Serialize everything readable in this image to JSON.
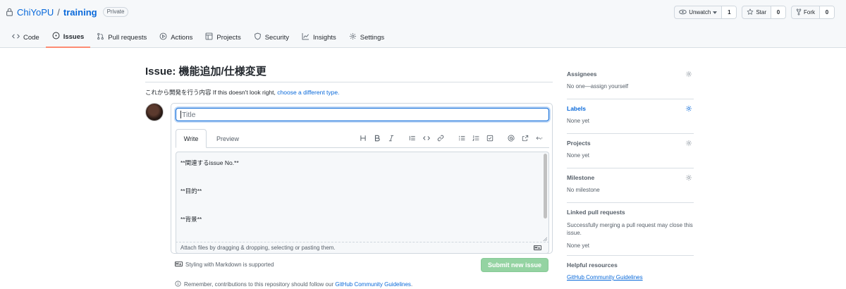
{
  "repo": {
    "owner": "ChiYoPU",
    "slash": "/",
    "name": "training",
    "visibility": "Private"
  },
  "repo_actions": {
    "watch_label": "Unwatch",
    "watch_count": "1",
    "star_label": "Star",
    "star_count": "0",
    "fork_label": "Fork",
    "fork_count": "0"
  },
  "tabs": [
    {
      "label": "Code",
      "icon": "code-icon"
    },
    {
      "label": "Issues",
      "icon": "issue-opened-icon",
      "active": true
    },
    {
      "label": "Pull requests",
      "icon": "pull-request-icon"
    },
    {
      "label": "Actions",
      "icon": "play-icon"
    },
    {
      "label": "Projects",
      "icon": "table-icon"
    },
    {
      "label": "Security",
      "icon": "shield-icon"
    },
    {
      "label": "Insights",
      "icon": "graph-icon"
    },
    {
      "label": "Settings",
      "icon": "gear-icon"
    }
  ],
  "issue": {
    "heading": "Issue: 機能追加/仕様変更",
    "template_note": "これから開発を行う内容 If this doesn't look right, ",
    "template_link": "choose a different type."
  },
  "editor": {
    "title_placeholder": "Title",
    "write_tab": "Write",
    "preview_tab": "Preview",
    "body_lines": [
      "**関連するissue No.**",
      "**目的**",
      "**背景**"
    ],
    "attach_text": "Attach files by dragging & dropping, selecting or pasting them.",
    "markdown_note": "Styling with Markdown is supported",
    "submit_label": "Submit new issue"
  },
  "remember": {
    "text": "Remember, contributions to this repository should follow our ",
    "link": "GitHub Community Guidelines",
    "end": "."
  },
  "sidebar": {
    "assignees": {
      "title": "Assignees",
      "value": "No one—assign yourself"
    },
    "labels": {
      "title": "Labels",
      "value": "None yet"
    },
    "projects": {
      "title": "Projects",
      "value": "None yet"
    },
    "milestone": {
      "title": "Milestone",
      "value": "No milestone"
    },
    "linked": {
      "title": "Linked pull requests",
      "description": "Successfully merging a pull request may close this issue.",
      "value": "None yet"
    },
    "help": {
      "title": "Helpful resources",
      "link": "GitHub Community Guidelines"
    }
  },
  "colors": {
    "link": "#0969da",
    "active_tab_underline": "#fd8c73",
    "submit_disabled": "#94d3a2"
  }
}
